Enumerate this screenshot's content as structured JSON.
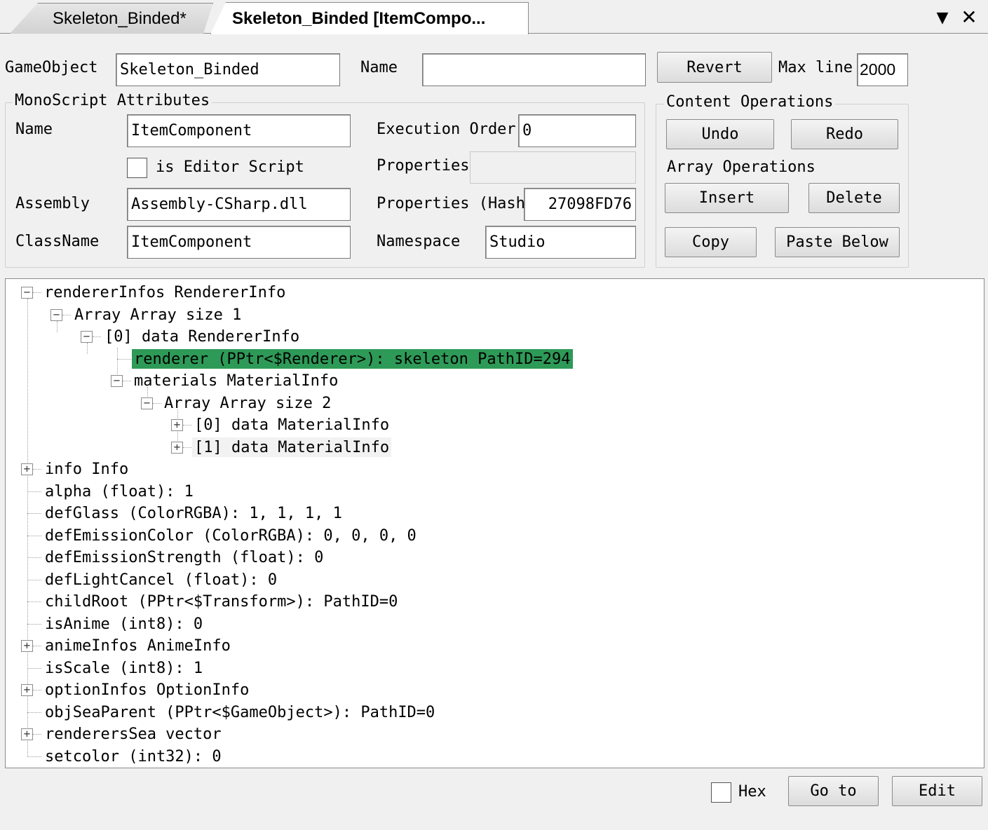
{
  "tabs": [
    {
      "label": "Skeleton_Binded*",
      "active": false
    },
    {
      "label": "Skeleton_Binded [ItemCompo...",
      "active": true
    }
  ],
  "toolbar": {
    "menu_icon": "chevron-down-icon",
    "close_icon": "close-icon"
  },
  "header": {
    "gameobject_label": "GameObject",
    "gameobject_value": "Skeleton_Binded",
    "name_label": "Name",
    "name_value": "",
    "revert_label": "Revert",
    "maxline_label": "Max line",
    "maxline_value": "2000"
  },
  "mono": {
    "group_label": "MonoScript Attributes",
    "name_label": "Name",
    "name_value": "ItemComponent",
    "editor_script_label": "is Editor Script",
    "editor_script_checked": false,
    "assembly_label": "Assembly",
    "assembly_value": "Assembly-CSharp.dll",
    "classname_label": "ClassName",
    "classname_value": "ItemComponent",
    "exec_order_label": "Execution Order",
    "exec_order_value": "0",
    "properties_label": "Properties",
    "properties_value": "",
    "prop_hash_label": "Properties (Hash)",
    "prop_hash_value": "27098FD76",
    "namespace_label": "Namespace",
    "namespace_value": "Studio"
  },
  "content_ops": {
    "label": "Content Operations",
    "undo": "Undo",
    "redo": "Redo"
  },
  "array_ops": {
    "label": "Array Operations",
    "insert": "Insert",
    "delete": "Delete",
    "copy": "Copy",
    "paste_below": "Paste Below"
  },
  "tree": [
    "rendererInfos RendererInfo",
    "Array Array size 1",
    "[0] data RendererInfo",
    "renderer (PPtr<$Renderer>): skeleton PathID=294",
    "materials MaterialInfo",
    "Array Array size 2",
    "[0] data MaterialInfo",
    "[1] data MaterialInfo",
    "info Info",
    "alpha (float): 1",
    "defGlass (ColorRGBA): 1, 1, 1, 1",
    "defEmissionColor (ColorRGBA): 0, 0, 0, 0",
    "defEmissionStrength (float): 0",
    "defLightCancel (float): 0",
    "childRoot (PPtr<$Transform>): PathID=0",
    "isAnime (int8): 0",
    "animeInfos AnimeInfo",
    "isScale (int8): 1",
    "optionInfos OptionInfo",
    "objSeaParent (PPtr<$GameObject>): PathID=0",
    "renderersSea vector",
    "setcolor (int32): 0"
  ],
  "footer": {
    "hex_label": "Hex",
    "hex_checked": false,
    "goto_label": "Go to",
    "edit_label": "Edit"
  }
}
